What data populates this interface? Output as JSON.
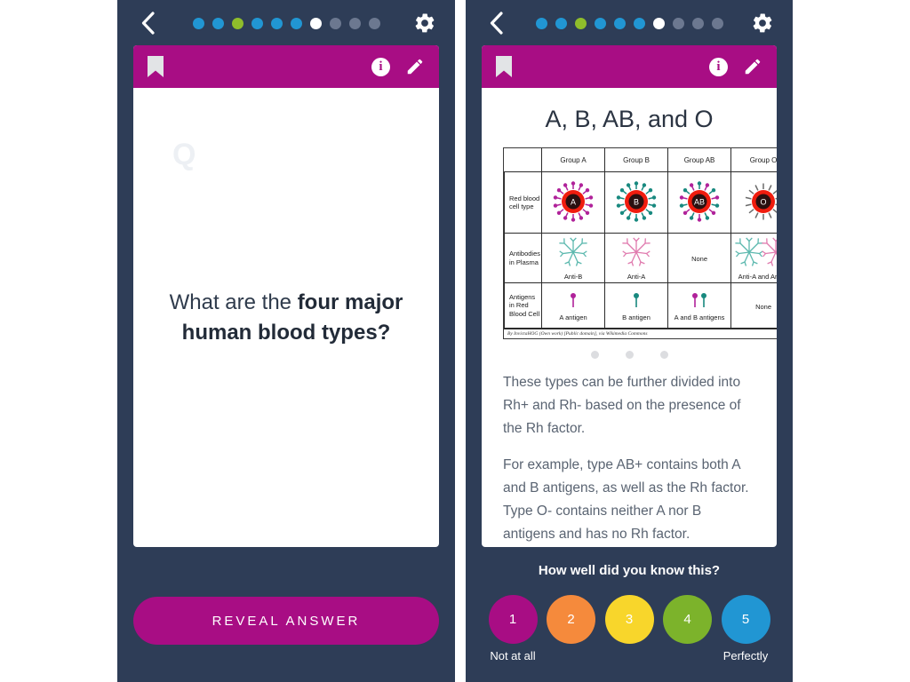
{
  "colors": {
    "app_background": "#2e3d57",
    "page_background": "#ffffff",
    "accent_magenta": "#a80d84",
    "card_white": "#ffffff",
    "dot_blue": "#2196d3",
    "dot_green": "#8fbd2b",
    "dot_current": "#ffffff",
    "dot_inactive": "#6c7890"
  },
  "left_screen": {
    "topbar": {
      "back_label": "Back",
      "settings_label": "Settings",
      "progress_dots": [
        {
          "state": "done",
          "color": "#2196d3"
        },
        {
          "state": "done",
          "color": "#2196d3"
        },
        {
          "state": "done",
          "color": "#8fbd2b"
        },
        {
          "state": "done",
          "color": "#2196d3"
        },
        {
          "state": "done",
          "color": "#2196d3"
        },
        {
          "state": "done",
          "color": "#2196d3"
        },
        {
          "state": "current",
          "color": "#ffffff"
        },
        {
          "state": "upcoming",
          "color": "#6c7890"
        },
        {
          "state": "upcoming",
          "color": "#6c7890"
        },
        {
          "state": "upcoming",
          "color": "#6c7890"
        }
      ]
    },
    "card_header": {
      "bookmark_label": "Bookmark",
      "info_label": "i",
      "edit_label": "Edit"
    },
    "watermark": "Q",
    "question": {
      "lead": "What are the ",
      "emphasis": "four major human blood types?"
    },
    "reveal_button": "REVEAL ANSWER"
  },
  "right_screen": {
    "topbar": {
      "back_label": "Back",
      "settings_label": "Settings",
      "progress_dots": [
        {
          "state": "done",
          "color": "#2196d3"
        },
        {
          "state": "done",
          "color": "#2196d3"
        },
        {
          "state": "done",
          "color": "#8fbd2b"
        },
        {
          "state": "done",
          "color": "#2196d3"
        },
        {
          "state": "done",
          "color": "#2196d3"
        },
        {
          "state": "done",
          "color": "#2196d3"
        },
        {
          "state": "current",
          "color": "#ffffff"
        },
        {
          "state": "upcoming",
          "color": "#6c7890"
        },
        {
          "state": "upcoming",
          "color": "#6c7890"
        },
        {
          "state": "upcoming",
          "color": "#6c7890"
        }
      ]
    },
    "card_header": {
      "bookmark_label": "Bookmark",
      "info_label": "i",
      "edit_label": "Edit"
    },
    "answer_title": "A, B, AB, and O",
    "figure": {
      "corner": "",
      "columns": [
        "Group A",
        "Group B",
        "Group AB",
        "Group O"
      ],
      "rows": [
        {
          "header": "Red blood cell type",
          "cells": [
            "A",
            "B",
            "AB",
            "O"
          ]
        },
        {
          "header": "Antibodies in Plasma",
          "cells": [
            "Anti-B",
            "Anti-A",
            "None",
            "Anti-A and Anti-B"
          ]
        },
        {
          "header": "Antigens in Red Blood Cell",
          "cells": [
            "A antigen",
            "B antigen",
            "A and B antigens",
            "None"
          ]
        }
      ],
      "caption": "By InvictaHOG (Own work) [Public domain], via Wikimedia Commons"
    },
    "carousel": {
      "count": 3,
      "active": 0
    },
    "paragraphs": [
      "These types can be further divided into Rh+ and Rh- based on the presence of the Rh factor.",
      "For example, type AB+ contains both A and B antigens, as well as the Rh factor. Type O- contains neither A nor B antigens and has no Rh factor."
    ],
    "rating": {
      "prompt": "How well did you know this?",
      "options": [
        {
          "value": "1",
          "color": "#a80d84",
          "caption": "Not at all"
        },
        {
          "value": "2",
          "color": "#f58a3c",
          "caption": ""
        },
        {
          "value": "3",
          "color": "#f8d62b",
          "caption": ""
        },
        {
          "value": "4",
          "color": "#7cb32b",
          "caption": ""
        },
        {
          "value": "5",
          "color": "#2196d3",
          "caption": "Perfectly"
        }
      ]
    }
  }
}
